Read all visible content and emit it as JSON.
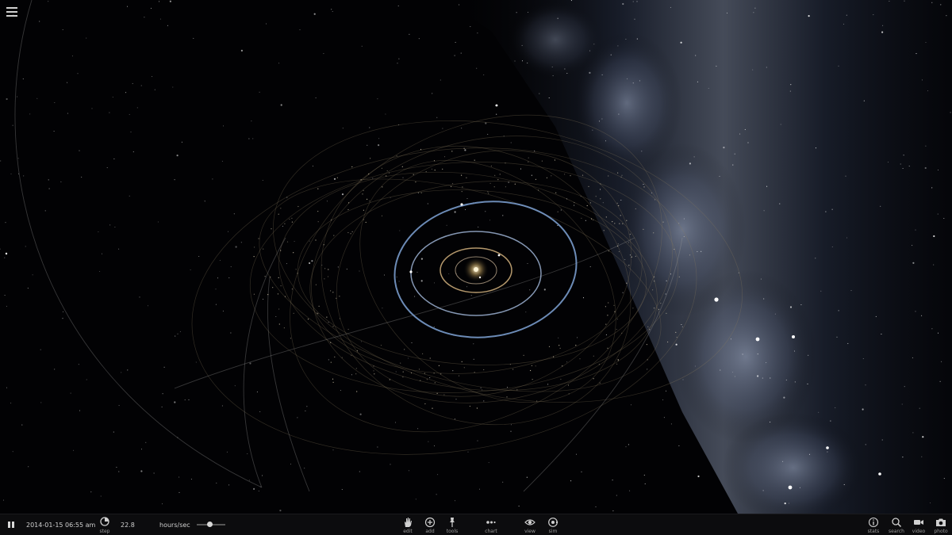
{
  "simulation": {
    "date_time": "2014-01-15 06:55 am",
    "step_value": "22.8",
    "step_unit": "hours/sec",
    "speed_level": 0.45
  },
  "toolbar": {
    "step_label": "step",
    "center_tools": [
      {
        "id": "edit",
        "label": "edit",
        "icon": "hand-icon"
      },
      {
        "id": "add",
        "label": "add",
        "icon": "plus-circle-icon"
      },
      {
        "id": "tools",
        "label": "tools",
        "icon": "pin-icon"
      },
      {
        "id": "chart",
        "label": "chart",
        "icon": "dots-icon"
      },
      {
        "id": "view",
        "label": "view",
        "icon": "eye-icon"
      },
      {
        "id": "sim",
        "label": "sim",
        "icon": "orbit-icon"
      }
    ],
    "right_tools": [
      {
        "id": "stats",
        "label": "stats",
        "icon": "info-icon"
      },
      {
        "id": "search",
        "label": "search",
        "icon": "magnifier-icon"
      },
      {
        "id": "video",
        "label": "video",
        "icon": "camera-video-icon"
      },
      {
        "id": "photo",
        "label": "photo",
        "icon": "camera-photo-icon"
      }
    ]
  },
  "colors": {
    "background": "#020204",
    "toolbar": "#0c0c0e",
    "orbit_earth": "#7fa3d6",
    "orbit_faint": "#8a7a5e",
    "milky_way": "#8a95ad"
  }
}
